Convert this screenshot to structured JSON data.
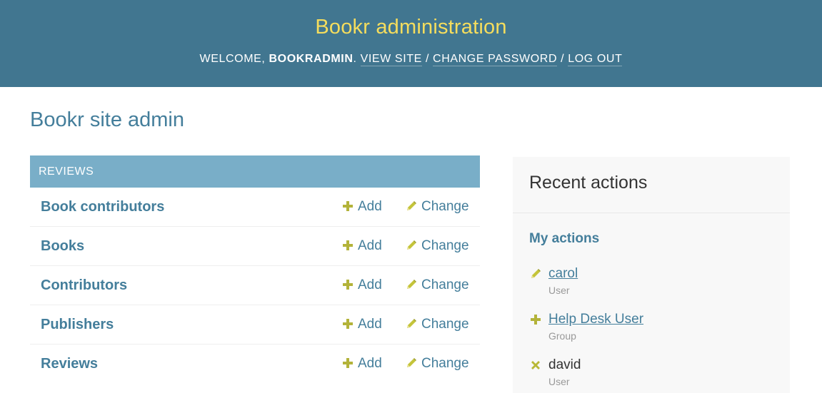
{
  "header": {
    "site_name": "Bookr administration",
    "welcome": "Welcome,",
    "username": "bookradmin",
    "view_site": "View site",
    "change_password": "Change password",
    "log_out": "Log out",
    "separator": "/"
  },
  "page_title": "Bookr site admin",
  "app": {
    "caption": "Reviews",
    "add_label": "Add",
    "change_label": "Change",
    "models": [
      {
        "name": "Book contributors"
      },
      {
        "name": "Books"
      },
      {
        "name": "Contributors"
      },
      {
        "name": "Publishers"
      },
      {
        "name": "Reviews"
      }
    ]
  },
  "recent_actions": {
    "title": "Recent actions",
    "my_actions_title": "My actions",
    "items": [
      {
        "name": "carol",
        "type": "User",
        "action_icon": "pencil-icon"
      },
      {
        "name": "Help Desk User",
        "type": "Group",
        "action_icon": "plus-icon"
      },
      {
        "name": "david",
        "type": "User",
        "action_icon": "x-icon"
      }
    ]
  },
  "colors": {
    "header_bg": "#417690",
    "site_name": "#f5dd5d",
    "caption_bg": "#79aec8",
    "link": "#447e9b",
    "icon_olive": "#b3b33a",
    "delete_icon": "#b8b836"
  }
}
